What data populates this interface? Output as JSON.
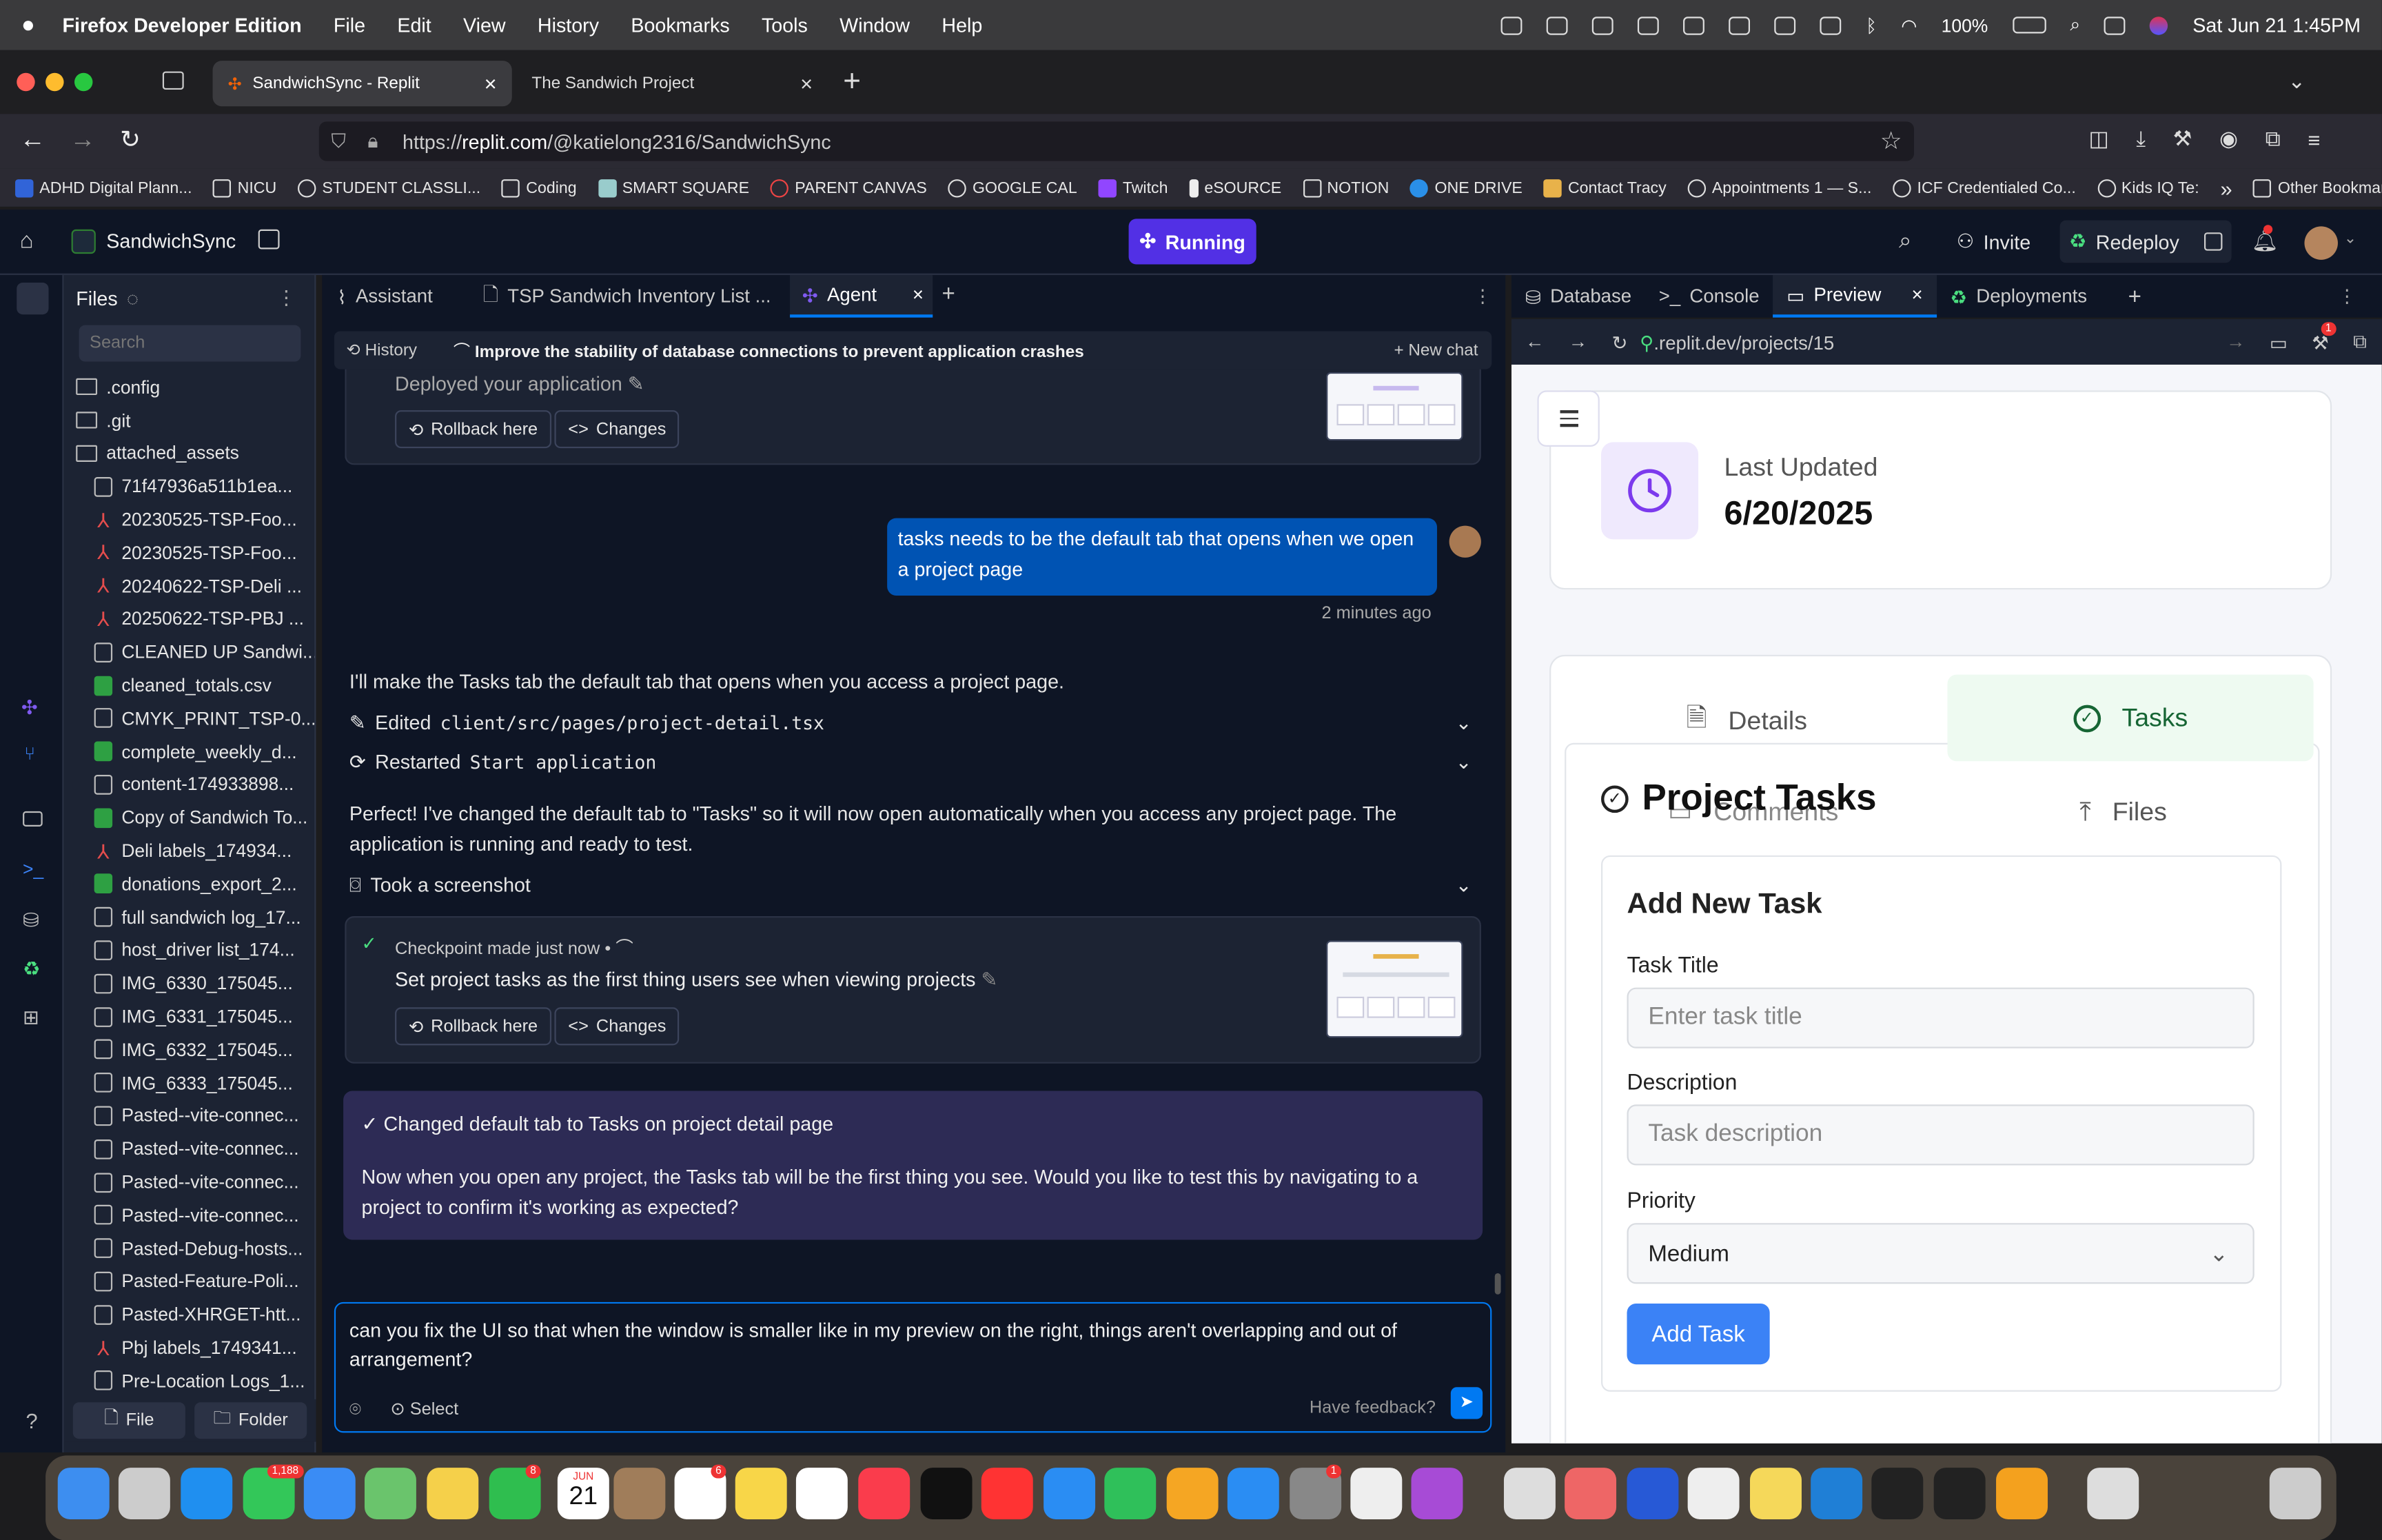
{
  "menubar": {
    "app_name": "Firefox Developer Edition",
    "menus": [
      "File",
      "Edit",
      "View",
      "History",
      "Bookmarks",
      "Tools",
      "Window",
      "Help"
    ],
    "battery": "100%",
    "datetime": "Sat Jun 21  1:45PM"
  },
  "browser": {
    "tabs": [
      {
        "label": "SandwichSync - Replit",
        "active": true
      },
      {
        "label": "The Sandwich Project",
        "active": false
      }
    ],
    "url_prefix": "https://",
    "url_host": "replit.com",
    "url_path": "/@katielong2316/SandwichSync",
    "bookmarks": [
      "ADHD Digital Plann...",
      "NICU",
      "STUDENT CLASSLI...",
      "Coding",
      "SMART SQUARE",
      "PARENT CANVAS",
      "GOOGLE CAL",
      "Twitch",
      "eSOURCE",
      "NOTION",
      "ONE DRIVE",
      "Contact Tracy",
      "Appointments 1 — S...",
      "ICF Credentialed Co...",
      "Kids IQ Te:"
    ],
    "other_bookmarks": "Other Bookmarks"
  },
  "replit": {
    "project_name": "SandwichSync",
    "status": "Running",
    "invite": "Invite",
    "redeploy": "Redeploy"
  },
  "files": {
    "title": "Files",
    "search_placeholder": "Search",
    "items": [
      {
        "name": ".config",
        "type": "folder",
        "indent": 0
      },
      {
        "name": ".git",
        "type": "folder",
        "indent": 0
      },
      {
        "name": "attached_assets",
        "type": "folder",
        "indent": 0
      },
      {
        "name": "71f47936a511b1ea...",
        "type": "file",
        "indent": 1
      },
      {
        "name": "20230525-TSP-Foo...",
        "type": "pdf",
        "indent": 1
      },
      {
        "name": "20230525-TSP-Foo...",
        "type": "pdf",
        "indent": 1
      },
      {
        "name": "20240622-TSP-Deli ...",
        "type": "pdf",
        "indent": 1
      },
      {
        "name": "20250622-TSP-PBJ ...",
        "type": "pdf",
        "indent": 1
      },
      {
        "name": "CLEANED UP Sandwi...",
        "type": "file",
        "indent": 1
      },
      {
        "name": "cleaned_totals.csv",
        "type": "csv",
        "indent": 1
      },
      {
        "name": "CMYK_PRINT_TSP-0...",
        "type": "img",
        "indent": 1
      },
      {
        "name": "complete_weekly_d...",
        "type": "csv",
        "indent": 1
      },
      {
        "name": "content-174933898...",
        "type": "md",
        "indent": 1
      },
      {
        "name": "Copy of Sandwich To...",
        "type": "csv",
        "indent": 1
      },
      {
        "name": "Deli labels_174934...",
        "type": "pdf",
        "indent": 1
      },
      {
        "name": "donations_export_2...",
        "type": "csv",
        "indent": 1
      },
      {
        "name": "full sandwich log_17...",
        "type": "file",
        "indent": 1
      },
      {
        "name": "host_driver list_174...",
        "type": "file",
        "indent": 1
      },
      {
        "name": "IMG_6330_175045...",
        "type": "img",
        "indent": 1
      },
      {
        "name": "IMG_6331_175045...",
        "type": "img",
        "indent": 1
      },
      {
        "name": "IMG_6332_175045...",
        "type": "img",
        "indent": 1
      },
      {
        "name": "IMG_6333_175045...",
        "type": "img",
        "indent": 1
      },
      {
        "name": "Pasted--vite-connec...",
        "type": "file",
        "indent": 1
      },
      {
        "name": "Pasted--vite-connec...",
        "type": "file",
        "indent": 1
      },
      {
        "name": "Pasted--vite-connec...",
        "type": "file",
        "indent": 1
      },
      {
        "name": "Pasted--vite-connec...",
        "type": "file",
        "indent": 1
      },
      {
        "name": "Pasted-Debug-hosts...",
        "type": "file",
        "indent": 1
      },
      {
        "name": "Pasted-Feature-Poli...",
        "type": "file",
        "indent": 1
      },
      {
        "name": "Pasted-XHRGET-htt...",
        "type": "file",
        "indent": 1
      },
      {
        "name": "Pbj labels_1749341...",
        "type": "pdf",
        "indent": 1
      },
      {
        "name": "Pre-Location Logs_1...",
        "type": "file",
        "indent": 1
      }
    ],
    "new_file": "File",
    "new_folder": "Folder"
  },
  "agent": {
    "tabs": [
      "Assistant",
      "TSP Sandwich Inventory List ...",
      "Agent"
    ],
    "history": "History",
    "chat_title": "Improve the stability of database connections to prevent application crashes",
    "new_chat": "New chat",
    "prev_checkpoint": "Deployed your application",
    "rollback": "Rollback here",
    "changes": "Changes",
    "user_message": "tasks needs to be the default tab that opens when we open a project page",
    "user_time": "2 minutes ago",
    "reply_intro": "I'll make the Tasks tab the default tab that opens when you access a project page.",
    "edited_label": "Edited",
    "edited_file": "client/src/pages/project-detail.tsx",
    "restarted_label": "Restarted",
    "restarted_target": "Start application",
    "reply_done": "Perfect! I've changed the default tab to \"Tasks\" so it will now open automatically when you access any project page. The application is running and ready to test.",
    "screenshot": "Took a screenshot",
    "checkpoint_label": "Checkpoint made just now",
    "checkpoint_sep": "•",
    "checkpoint_title": "Set project tasks as the first thing users see when viewing projects",
    "summary_title": "✓ Changed default tab to Tasks on project detail page",
    "summary_body": "Now when you open any project, the Tasks tab will be the first thing you see. Would you like to test this by navigating to a project to confirm it's working as expected?",
    "input_text": "can you fix the UI so that when the window is smaller like in my preview on the right, things aren't overlapping and out of arrangement?",
    "select": "Select",
    "feedback": "Have feedback?"
  },
  "preview": {
    "tabs": [
      "Database",
      "Console",
      "Preview",
      "Deployments"
    ],
    "url": ".replit.dev/projects/15",
    "last_updated_label": "Last Updated",
    "last_updated_value": "6/20/2025",
    "tab_details": "Details",
    "tab_tasks": "Tasks",
    "tab_comments": "Comments",
    "tab_files": "Files",
    "section_title": "Project Tasks",
    "form_title": "Add New Task",
    "task_title_label": "Task Title",
    "task_title_placeholder": "Enter task title",
    "description_label": "Description",
    "description_placeholder": "Task description",
    "priority_label": "Priority",
    "priority_value": "Medium",
    "add_button": "Add Task",
    "notification_count": "1"
  },
  "dock": {
    "badges": [
      "1,188",
      "8",
      "6",
      "1"
    ],
    "calendar_month": "JUN",
    "calendar_day": "21"
  },
  "colors": {
    "replit_bg": "#0e1525",
    "running": "#5230e5",
    "user_bubble": "#0053b3",
    "primary_button": "#3b82f6",
    "tasks_active_bg": "#eefaf1"
  }
}
